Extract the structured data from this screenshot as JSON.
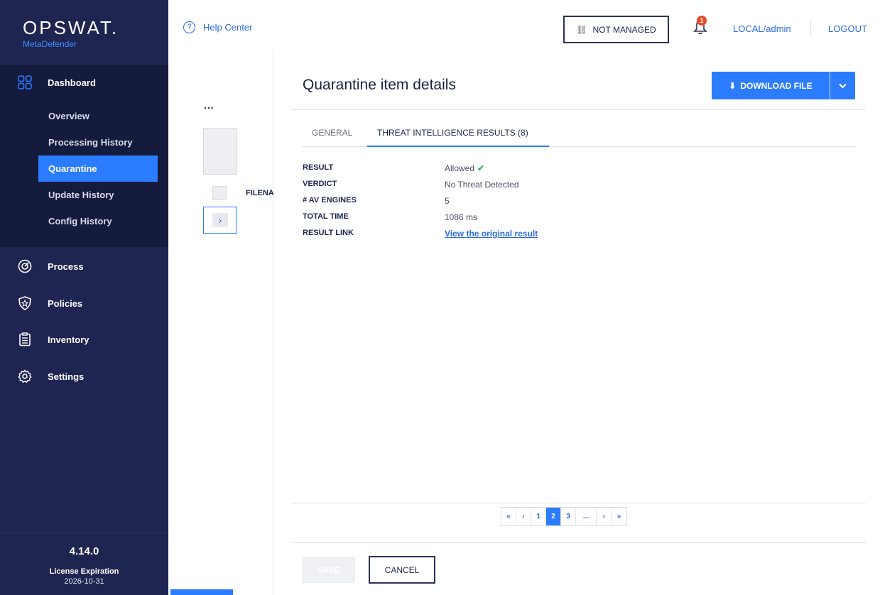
{
  "brand": {
    "name": "OPSWAT.",
    "product": "MetaDefender"
  },
  "sidebar": {
    "dashboard_label": "Dashboard",
    "sub_items": [
      {
        "label": "Overview",
        "active": false
      },
      {
        "label": "Processing History",
        "active": false
      },
      {
        "label": "Quarantine",
        "active": true
      },
      {
        "label": "Update History",
        "active": false
      },
      {
        "label": "Config History",
        "active": false
      }
    ],
    "main_items": [
      {
        "label": "Process",
        "icon": "process-icon"
      },
      {
        "label": "Policies",
        "icon": "shield-star-icon"
      },
      {
        "label": "Inventory",
        "icon": "clipboard-icon"
      },
      {
        "label": "Settings",
        "icon": "gear-icon"
      }
    ],
    "version": "4.14.0",
    "license_label": "License Expiration",
    "license_date": "2026-10-31"
  },
  "header": {
    "help_label": "Help Center",
    "not_managed_label": "NOT MANAGED",
    "notification_count": "1",
    "user_label": "LOCAL/admin",
    "logout_label": "LOGOUT"
  },
  "list": {
    "more_label": "...",
    "column_label": "FILENA"
  },
  "detail": {
    "title": "Quarantine item details",
    "download_label": "DOWNLOAD FILE",
    "tabs": [
      {
        "label": "GENERAL",
        "active": false
      },
      {
        "label": "THREAT INTELLIGENCE RESULTS (8)",
        "active": true
      }
    ],
    "fields": {
      "result_key": "RESULT",
      "result_val": "Allowed",
      "verdict_key": "VERDICT",
      "verdict_val": "No Threat Detected",
      "engines_key": "# AV ENGINES",
      "engines_val": "5",
      "time_key": "TOTAL TIME",
      "time_val": "1086 ms",
      "link_key": "RESULT LINK",
      "link_val": "View the original result"
    },
    "pagination": {
      "first": "«",
      "prev": "‹",
      "pages": [
        "1",
        "2",
        "3"
      ],
      "current": "2",
      "ellipsis": "...",
      "next": "›",
      "last": "»"
    },
    "save_label": "SAVE",
    "cancel_label": "CANCEL"
  },
  "colors": {
    "sidebar": "#1d2550",
    "sidebar_dark": "#141b3d",
    "accent": "#2b7cff",
    "success": "#2eb86b",
    "badge": "#e04f2e"
  }
}
